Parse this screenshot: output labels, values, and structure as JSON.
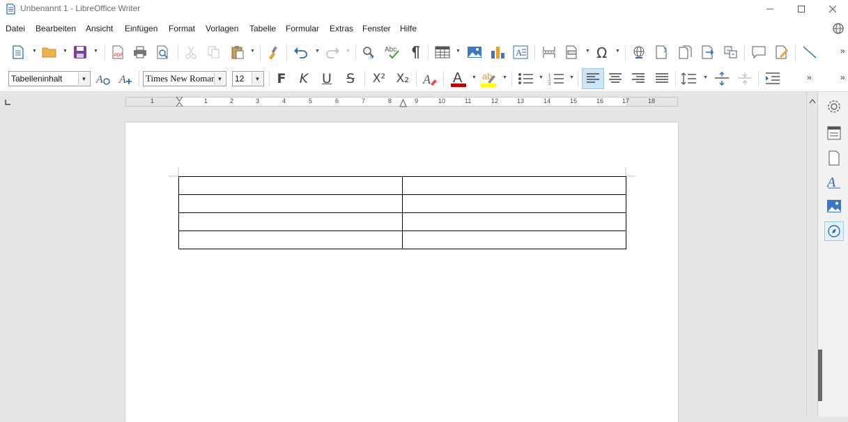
{
  "window": {
    "title": "Unbenannt 1 - LibreOffice Writer"
  },
  "menu": {
    "items": [
      "Datei",
      "Bearbeiten",
      "Ansicht",
      "Einfügen",
      "Format",
      "Vorlagen",
      "Tabelle",
      "Formular",
      "Extras",
      "Fenster",
      "Hilfe"
    ]
  },
  "formatting": {
    "paragraph_style": "Tabelleninhalt",
    "font_name": "Times New Roman",
    "font_size": "12",
    "bold_label": "F",
    "italic_label": "K",
    "underline_label": "U",
    "strike_label": "S",
    "superscript_label": "X²",
    "subscript_label": "X₂",
    "font_color": "#c00000",
    "highlight_color": "#ffff00"
  },
  "ruler": {
    "numbers": [
      "1",
      "1",
      "2",
      "3",
      "4",
      "5",
      "6",
      "7",
      "8",
      "9",
      "10",
      "11",
      "12",
      "13",
      "14",
      "15",
      "16",
      "17",
      "18"
    ]
  },
  "document": {
    "table": {
      "rows": 4,
      "cols": 2,
      "cells": [
        [
          "",
          ""
        ],
        [
          "",
          ""
        ],
        [
          "",
          ""
        ],
        [
          "",
          ""
        ]
      ]
    }
  },
  "colors": {
    "accent": "#2b579a",
    "active_align_bg": "#cce4f7"
  }
}
